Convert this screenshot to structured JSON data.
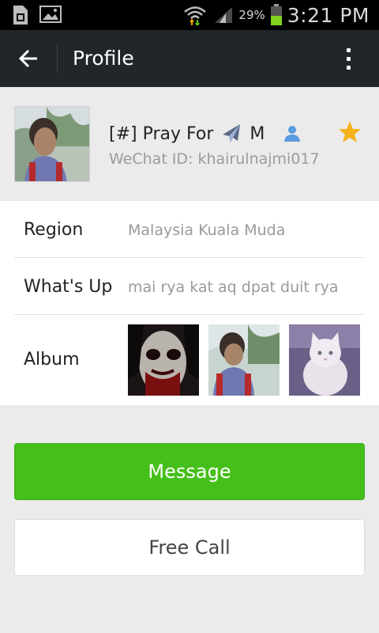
{
  "status_bar": {
    "battery_percent": "29%",
    "time": "3:21 PM",
    "icons": [
      "sim-card-icon",
      "gallery-icon",
      "wifi-icon",
      "signal-icon",
      "battery-icon"
    ]
  },
  "appbar": {
    "title": "Profile",
    "back_icon": "arrow-back-icon",
    "menu_icon": "more-vertical-icon"
  },
  "profile": {
    "name_prefix": "[#] Pray For",
    "name_emoji_icon": "airplane-icon",
    "name_suffix": "M",
    "gender_icon": "person-icon",
    "wechat_id": "WeChat ID: khairulnajmi017",
    "starred": true,
    "colors": {
      "star": "#f5b31b",
      "person": "#5b9be0"
    }
  },
  "info": {
    "region": {
      "label": "Region",
      "value": "Malaysia  Kuala Muda"
    },
    "whats_up": {
      "label": "What's Up",
      "value": "mai rya kat aq dpat duit rya"
    },
    "album": {
      "label": "Album",
      "photos": [
        "album-photo-ghost",
        "album-photo-boy",
        "album-photo-kitten"
      ]
    }
  },
  "actions": {
    "message": "Message",
    "free_call": "Free Call"
  },
  "colors": {
    "accent_green": "#45c01a",
    "appbar": "#20262a",
    "background": "#ebebeb"
  }
}
